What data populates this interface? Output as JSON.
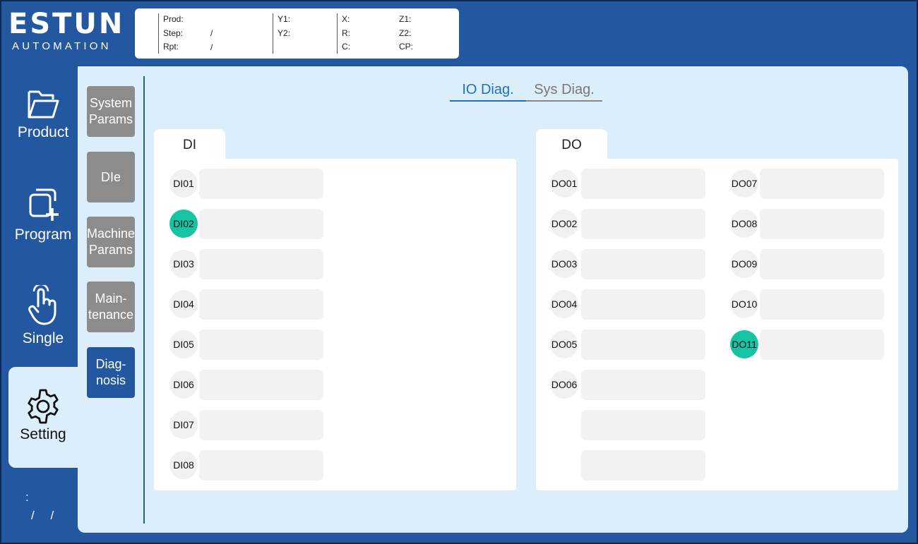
{
  "logo": {
    "main": "ESTUN",
    "sub": "AUTOMATION"
  },
  "info": {
    "col1": [
      "Prod:",
      "Step:",
      "Rpt:"
    ],
    "step_value": "/",
    "rpt_value": "/",
    "col2": [
      "Y1:",
      "Y2:"
    ],
    "col3": [
      "X:",
      "R:",
      "C:"
    ],
    "col4": [
      "Z1:",
      "Z2:",
      "CP:"
    ]
  },
  "nav": {
    "items": [
      {
        "label": "Product",
        "icon": "folder-icon"
      },
      {
        "label": "Program",
        "icon": "copy-add-icon"
      },
      {
        "label": "Single",
        "icon": "hand-pointer-icon"
      },
      {
        "label": "Setting",
        "icon": "gear-icon"
      }
    ],
    "active": "Setting"
  },
  "status": {
    "line1": ":",
    "line2": "/ /"
  },
  "sub_nav": [
    {
      "label": "System\nParams",
      "active": false
    },
    {
      "label": "DIe",
      "active": false
    },
    {
      "label": "Machine\nParams",
      "active": false
    },
    {
      "label": "Main-\ntenance",
      "active": false
    },
    {
      "label": "Diag-\nnosis",
      "active": true
    }
  ],
  "tabs": {
    "io": "IO Diag.",
    "sys": "Sys Diag.",
    "active": "io"
  },
  "di": {
    "title": "DI",
    "items": [
      {
        "label": "DI01",
        "on": false
      },
      {
        "label": "DI02",
        "on": true
      },
      {
        "label": "DI03",
        "on": false
      },
      {
        "label": "DI04",
        "on": false
      },
      {
        "label": "DI05",
        "on": false
      },
      {
        "label": "DI06",
        "on": false
      },
      {
        "label": "DI07",
        "on": false
      },
      {
        "label": "DI08",
        "on": false
      }
    ]
  },
  "do": {
    "title": "DO",
    "left_items": [
      {
        "label": "DO01",
        "on": false
      },
      {
        "label": "DO02",
        "on": false
      },
      {
        "label": "DO03",
        "on": false
      },
      {
        "label": "DO04",
        "on": false
      },
      {
        "label": "DO05",
        "on": false
      },
      {
        "label": "DO06",
        "on": false
      }
    ],
    "right_items": [
      {
        "label": "DO07",
        "on": false
      },
      {
        "label": "DO08",
        "on": false
      },
      {
        "label": "DO09",
        "on": false
      },
      {
        "label": "DO10",
        "on": false
      },
      {
        "label": "DO11",
        "on": true
      }
    ]
  },
  "colors": {
    "accent": "#2357a0",
    "on": "#16c3a3",
    "tab_active": "#1f6fc0"
  }
}
